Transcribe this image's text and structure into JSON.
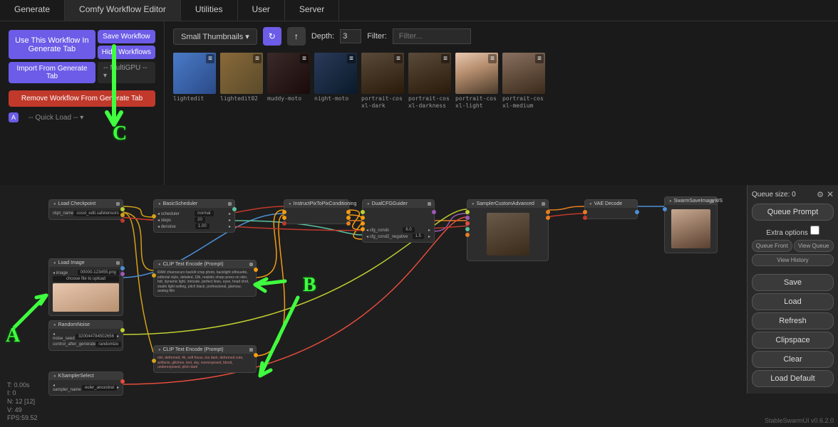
{
  "tabs": [
    "Generate",
    "Comfy Workflow Editor",
    "Utilities",
    "User",
    "Server"
  ],
  "activeTab": 1,
  "leftPanel": {
    "useWorkflow": "Use This Workflow In Generate Tab",
    "saveWorkflow": "Save Workflow",
    "hideWorkflows": "Hide Workflows",
    "importGenerate": "Import From Generate Tab",
    "multiGpu": "-- MultiGPU --",
    "removeWorkflow": "Remove Workflow From Generate Tab",
    "quickLoad": "-- Quick Load --",
    "badgeA": "A"
  },
  "browser": {
    "thumbMode": "Small Thumbnails",
    "depthLabel": "Depth:",
    "depthValue": "3",
    "filterLabel": "Filter:",
    "filterPlaceholder": "Filter...",
    "thumbs": [
      {
        "label": "lightedit",
        "cls": "moto1"
      },
      {
        "label": "lightedit02",
        "cls": "moto2"
      },
      {
        "label": "muddy-moto",
        "cls": "moto3"
      },
      {
        "label": "night-moto",
        "cls": "moto4"
      },
      {
        "label": "portrait-cos xl-dark",
        "cls": "portrait-dark"
      },
      {
        "label": "portrait-cos xl-darkness",
        "cls": "portrait-dark"
      },
      {
        "label": "portrait-cos xl-light",
        "cls": "portrait"
      },
      {
        "label": "portrait-cos xl-medium",
        "cls": "portrait-med"
      }
    ]
  },
  "nodes": {
    "loadCheckpoint": {
      "title": "Load Checkpoint",
      "field1": "ckpt_name",
      "val1": "cosxl_edit.safetensors"
    },
    "loadImage": {
      "title": "Load Image",
      "field1": "image",
      "val1": "00000-123455.png",
      "upload": "choose file to upload"
    },
    "randomNoise": {
      "title": "RandomNoise",
      "field1": "noise_seed",
      "val1": "320044784502656",
      "field2": "control_after_generate",
      "val2": "randomize"
    },
    "ksampler": {
      "title": "KSamplerSelect",
      "field1": "sampler_name",
      "val1": "euler_ancestral"
    },
    "basicScheduler": {
      "title": "BasicScheduler",
      "f1": "scheduler",
      "v1": "normal",
      "f2": "steps",
      "v2": "20",
      "f3": "denoise",
      "v3": "1.00"
    },
    "clipPos": {
      "title": "CLIP Text Encode (Prompt)",
      "text": "RAW chiaroscuro backlit crisp photo, backlight silhouette, editorial style, detailed, 18k, realistic sharp pores on skin, hdr, dynamic light, intricate, perfect lines, eyes, head shot, studio light setting, pitch black, professional, glamour, analog film"
    },
    "clipNeg": {
      "title": "CLIP Text Encode (Prompt)",
      "text": "nlxl, deformed, 4k, soft focus, too dark, deformed cute, artifacts, glitches, text, sky, overexposed, blood, underexposed, pitch dark"
    },
    "instructPix": {
      "title": "InstructPixToPixConditioning"
    },
    "dualCfg": {
      "title": "DualCFGGuider",
      "f1": "cfg_conds",
      "v1": "6.0",
      "f2": "cfg_cond2_negative",
      "v2": "1.5"
    },
    "samplerAdv": {
      "title": "SamplerCustomAdvanced"
    },
    "vaeDecode": {
      "title": "VAE Decode"
    },
    "swarmSave": {
      "title": "SwarmSaveImageWS"
    }
  },
  "rightPanel": {
    "queueSize": "Queue size: 0",
    "queuePrompt": "Queue Prompt",
    "extraOptions": "Extra options",
    "queueFront": "Queue Front",
    "viewQueue": "View Queue",
    "viewHistory": "View History",
    "buttons": [
      "Save",
      "Load",
      "Refresh",
      "Clipspace",
      "Clear",
      "Load Default"
    ]
  },
  "stats": {
    "t": "T: 0.00s",
    "i": "I: 0",
    "n": "N: 12 [12]",
    "v": "V: 49",
    "fps": "FPS:59.52"
  },
  "footer": "StableSwarmUI v0.6.2.0",
  "annotations": {
    "a": "A",
    "b": "B",
    "c": "C"
  }
}
